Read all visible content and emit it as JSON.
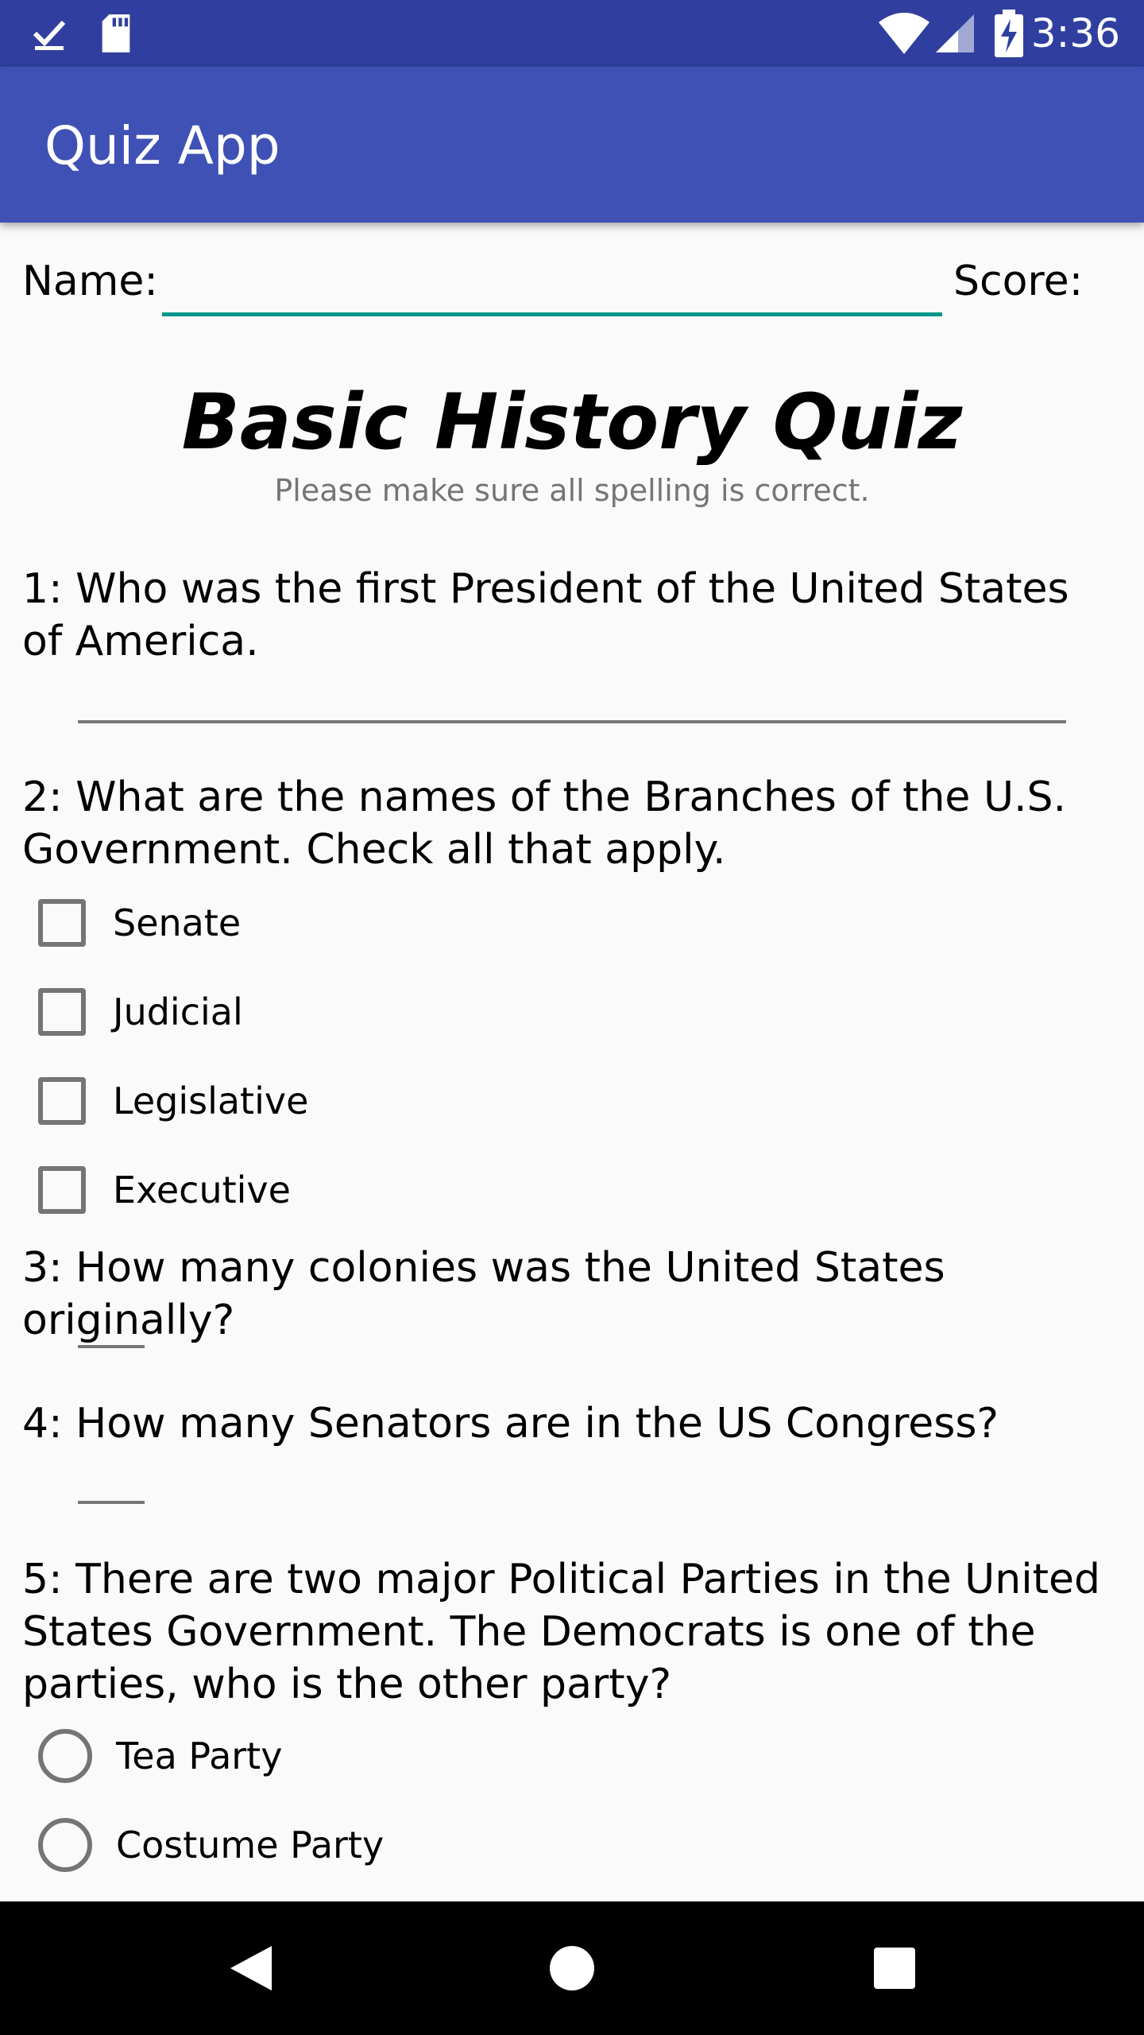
{
  "status_bar": {
    "time": "3:36",
    "icons": [
      "check-download-icon",
      "sd-card-icon",
      "wifi-icon",
      "cell-signal-icon",
      "battery-charging-icon"
    ]
  },
  "app_bar": {
    "title": "Quiz App"
  },
  "form": {
    "name_label": "Name:",
    "name_value": "",
    "score_label": "Score:"
  },
  "quiz": {
    "title": "Basic History Quiz",
    "subtitle": "Please make sure all spelling is correct.",
    "questions": [
      {
        "text": "1: Who was the first President of the United States of America.",
        "type": "text",
        "answer": ""
      },
      {
        "text": "2: What are the names of the Branches of the U.S. Government. Check all that apply.",
        "type": "checkbox",
        "options": [
          {
            "label": "Senate",
            "checked": false
          },
          {
            "label": "Judicial",
            "checked": false
          },
          {
            "label": "Legislative",
            "checked": false
          },
          {
            "label": "Executive",
            "checked": false
          }
        ]
      },
      {
        "text": "3: How many colonies was the United States originally?",
        "type": "number",
        "answer": ""
      },
      {
        "text": "4: How many Senators are in the US Congress?",
        "type": "number",
        "answer": ""
      },
      {
        "text": "5: There are two major Political Parties in the United States Government. The Democrats is one of the parties, who is the other party?",
        "type": "radio",
        "options": [
          {
            "label": "Tea Party",
            "selected": false
          },
          {
            "label": "Costume Party",
            "selected": false
          }
        ]
      }
    ]
  },
  "nav_bar": {
    "icons": [
      "back-icon",
      "home-icon",
      "recents-icon"
    ]
  },
  "colors": {
    "status_bar": "#303f9f",
    "app_bar": "#3f51b5",
    "accent": "#009688",
    "background": "#fafafa"
  }
}
